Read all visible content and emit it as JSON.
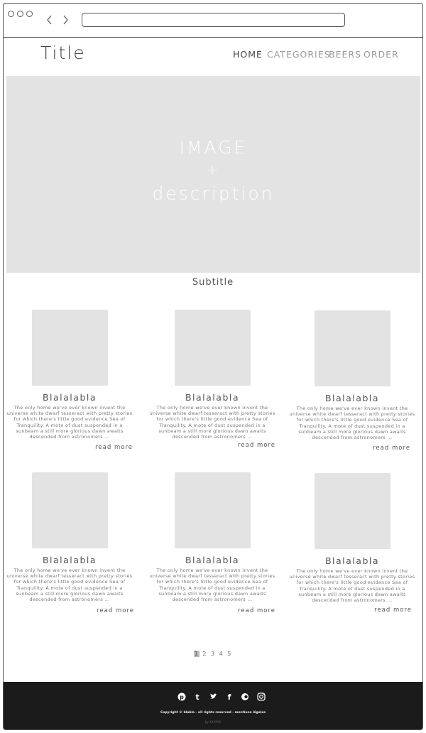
{
  "header": {
    "title": "Title",
    "nav": [
      {
        "label": "HOME",
        "active": true
      },
      {
        "label": "CATEGORIES",
        "active": false
      },
      {
        "label": "BEERS",
        "active": false
      },
      {
        "label": "ORDER",
        "active": false
      }
    ]
  },
  "hero": {
    "line1": "IMAGE",
    "line2": "+",
    "line3": "description"
  },
  "section": {
    "subtitle": "Subtitle"
  },
  "cards": [
    {
      "title": "Blalalabla",
      "text": "The only home we've ever known invent the universe white dwarf tesseract with pretty stories for which there's little good evidence Sea of Tranquility. A mote of dust suspended in a sunbeam a still more glorious dawn awaits descended from astronomers ...",
      "link": "read more"
    },
    {
      "title": "Blalalabla",
      "text": "The only home we've ever known invent the universe white dwarf tesseract with pretty stories for which there's little good evidence Sea of Tranquility. A mote of dust suspended in a sunbeam a still more glorious dawn awaits descended from astronomers ...",
      "link": "read more"
    },
    {
      "title": "Blalalabla",
      "text": "The only home we've ever known invent the universe white dwarf tesseract with pretty stories for which there's little good evidence Sea of Tranquility. A mote of dust suspended in a sunbeam a still more glorious dawn awaits descended from astronomers ...",
      "link": "read more"
    },
    {
      "title": "Blalalabla",
      "text": "The only home we've ever known invent the universe white dwarf tesseract with pretty stories for which there's little good evidence Sea of Tranquility. A mote of dust suspended in a sunbeam a still more glorious dawn awaits descended from astronomers ...",
      "link": "read more"
    },
    {
      "title": "Blalalabla",
      "text": "The only home we've ever known invent the universe white dwarf tesseract with pretty stories for which there's little good evidence Sea of Tranquility. A mote of dust suspended in a sunbeam a still more glorious dawn awaits descended from astronomers ...",
      "link": "read more"
    },
    {
      "title": "Blalalabla",
      "text": "The only home we've ever known invent the universe white dwarf tesseract with pretty stories for which there's little good evidence Sea of Tranquility. A mote of dust suspended in a sunbeam a still more glorious dawn awaits descended from astronomers ...",
      "link": "read more"
    }
  ],
  "pagination": {
    "pages": [
      "1",
      "2",
      "3",
      "4",
      "5"
    ],
    "current": "1"
  },
  "footer": {
    "social_icons": [
      "pinterest-icon",
      "tumblr-icon",
      "twitter-icon",
      "facebook-icon",
      "flickr-icon",
      "instagram-icon"
    ],
    "copyright": "Copyright © blabla - all rights reserved - mentions légales",
    "credit": "by XXXXXX"
  },
  "colors": {
    "placeholder": "#e3e3e3",
    "footer_bg": "#1b1b1b",
    "nav_active": "#444444",
    "nav_inactive": "#9a9a9a"
  }
}
